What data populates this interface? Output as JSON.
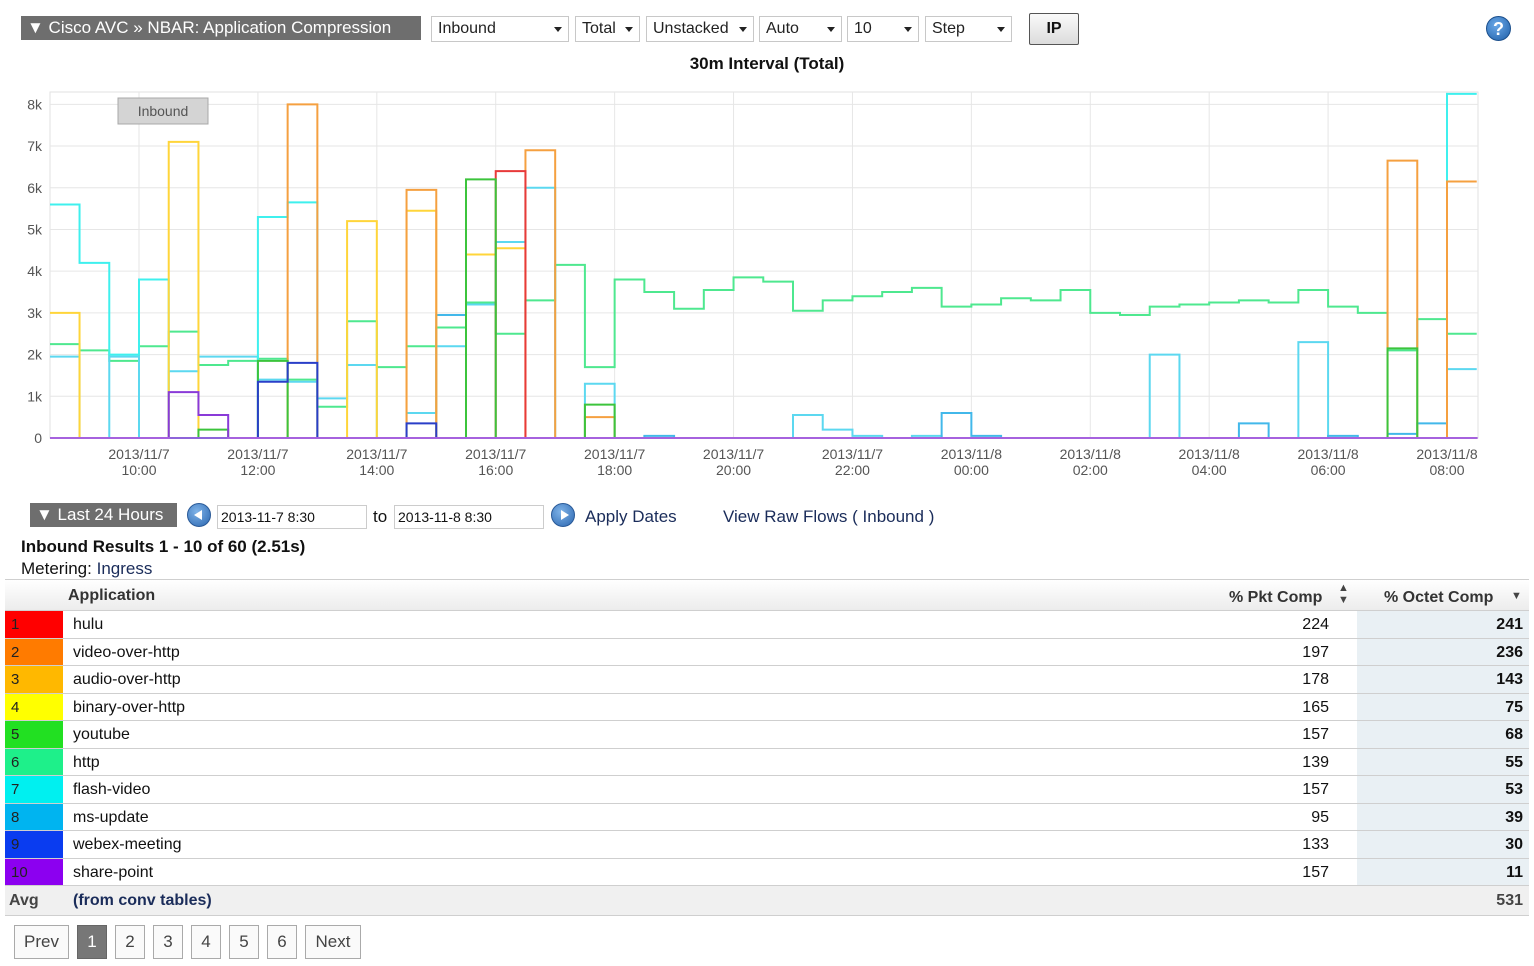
{
  "toolbar": {
    "title": "▼ Cisco AVC » NBAR: Application Compression",
    "direction": "Inbound",
    "total": "Total",
    "stack": "Unstacked",
    "scale": "Auto",
    "count": "10",
    "mode": "Step",
    "ip_label": "IP",
    "help": "?"
  },
  "chart_title": "30m Interval (Total)",
  "chart_data": {
    "type": "line",
    "title": "30m Interval (Total)",
    "legend": "Inbound",
    "y_ticks": [
      "0",
      "1k",
      "2k",
      "3k",
      "4k",
      "5k",
      "6k",
      "7k",
      "8k"
    ],
    "ylim": [
      0,
      8200
    ],
    "x_ticks": [
      {
        "date": "2013/11/7",
        "time": "10:00",
        "hour": 10
      },
      {
        "date": "2013/11/7",
        "time": "12:00",
        "hour": 12
      },
      {
        "date": "2013/11/7",
        "time": "14:00",
        "hour": 14
      },
      {
        "date": "2013/11/7",
        "time": "16:00",
        "hour": 16
      },
      {
        "date": "2013/11/7",
        "time": "18:00",
        "hour": 18
      },
      {
        "date": "2013/11/7",
        "time": "20:00",
        "hour": 20
      },
      {
        "date": "2013/11/7",
        "time": "22:00",
        "hour": 22
      },
      {
        "date": "2013/11/8",
        "time": "00:00",
        "hour": 24
      },
      {
        "date": "2013/11/8",
        "time": "02:00",
        "hour": 26
      },
      {
        "date": "2013/11/8",
        "time": "04:00",
        "hour": 28
      },
      {
        "date": "2013/11/8",
        "time": "06:00",
        "hour": 30
      },
      {
        "date": "2013/11/8",
        "time": "08:00",
        "hour": 32
      }
    ],
    "x_start_hour": 8.5,
    "interval_hours": 0.5,
    "series": [
      {
        "color": "#4ee88f",
        "values": [
          2250,
          2100,
          1850,
          2200,
          2550,
          1750,
          1850,
          1900,
          1400,
          750,
          2800,
          1700,
          2200,
          2650,
          3250,
          2500,
          3300,
          4150,
          1700,
          3800,
          3500,
          3100,
          3550,
          3850,
          3750,
          3050,
          3300,
          3400,
          3500,
          3600,
          3150,
          3200,
          3350,
          3300,
          3550,
          3000,
          2950,
          3150,
          3200,
          3250,
          3300,
          3250,
          3550,
          3150,
          3000,
          2100,
          2850,
          2500
        ]
      },
      {
        "color": "#5cd8f0",
        "values": [
          1950,
          0,
          1950,
          0,
          1600,
          1950,
          1950,
          1400,
          1350,
          950,
          1750,
          0,
          600,
          2200,
          3200,
          4700,
          6000,
          0,
          1300,
          0,
          0,
          0,
          0,
          0,
          0,
          550,
          200,
          50,
          0,
          50,
          0,
          0,
          0,
          0,
          0,
          0,
          0,
          2000,
          0,
          0,
          0,
          0,
          2300,
          0,
          0,
          0,
          0,
          1650
        ]
      },
      {
        "color": "#3ff0ee",
        "values": [
          5600,
          4200,
          2000,
          3800,
          0,
          0,
          0,
          5300,
          5650,
          0,
          0,
          0,
          0,
          0,
          0,
          0,
          0,
          0,
          0,
          0,
          0,
          0,
          0,
          0,
          0,
          0,
          0,
          0,
          0,
          0,
          0,
          0,
          0,
          0,
          0,
          0,
          0,
          0,
          0,
          0,
          0,
          0,
          0,
          0,
          0,
          0,
          0,
          8250
        ]
      },
      {
        "color": "#42b8ea",
        "values": [
          0,
          0,
          0,
          0,
          0,
          0,
          0,
          0,
          0,
          0,
          0,
          0,
          0,
          2950,
          0,
          0,
          0,
          0,
          0,
          0,
          50,
          0,
          0,
          0,
          0,
          0,
          0,
          0,
          0,
          0,
          600,
          50,
          0,
          0,
          0,
          0,
          0,
          0,
          0,
          0,
          350,
          0,
          0,
          50,
          0,
          100,
          350,
          0
        ]
      },
      {
        "color": "#ffd53a",
        "values": [
          3000,
          0,
          0,
          0,
          7100,
          0,
          0,
          0,
          0,
          0,
          5200,
          0,
          5450,
          0,
          4400,
          4550,
          0,
          0,
          0,
          0,
          0,
          0,
          0,
          0,
          0,
          0,
          0,
          0,
          0,
          0,
          0,
          0,
          0,
          0,
          0,
          0,
          0,
          0,
          0,
          0,
          0,
          0,
          0,
          0,
          0,
          0,
          0,
          0
        ]
      },
      {
        "color": "#f5a040",
        "values": [
          0,
          0,
          0,
          0,
          0,
          0,
          0,
          0,
          8000,
          0,
          0,
          0,
          5950,
          0,
          0,
          0,
          6900,
          0,
          500,
          0,
          0,
          0,
          0,
          0,
          0,
          0,
          0,
          0,
          0,
          0,
          0,
          0,
          0,
          0,
          0,
          0,
          0,
          0,
          0,
          0,
          0,
          0,
          0,
          0,
          0,
          6650,
          0,
          6150
        ]
      },
      {
        "color": "#e83a3a",
        "values": [
          0,
          0,
          0,
          0,
          0,
          0,
          0,
          0,
          0,
          0,
          0,
          0,
          0,
          0,
          0,
          6400,
          0,
          0,
          0,
          0,
          0,
          0,
          0,
          0,
          0,
          0,
          0,
          0,
          0,
          0,
          0,
          0,
          0,
          0,
          0,
          0,
          0,
          0,
          0,
          0,
          0,
          0,
          0,
          0,
          0,
          0,
          0,
          0
        ]
      },
      {
        "color": "#3cc43c",
        "values": [
          0,
          0,
          0,
          0,
          0,
          200,
          0,
          1850,
          0,
          0,
          0,
          0,
          0,
          0,
          6200,
          0,
          0,
          0,
          800,
          0,
          0,
          0,
          0,
          0,
          0,
          0,
          0,
          0,
          0,
          0,
          0,
          0,
          0,
          0,
          0,
          0,
          0,
          0,
          0,
          0,
          0,
          0,
          0,
          0,
          0,
          2150,
          0,
          0
        ]
      },
      {
        "color": "#2a3fc8",
        "values": [
          0,
          0,
          0,
          0,
          0,
          0,
          0,
          1350,
          1800,
          0,
          0,
          0,
          350,
          0,
          0,
          0,
          0,
          0,
          0,
          0,
          0,
          0,
          0,
          0,
          0,
          0,
          0,
          0,
          0,
          0,
          0,
          0,
          0,
          0,
          0,
          0,
          0,
          0,
          0,
          0,
          0,
          0,
          0,
          0,
          0,
          0,
          0,
          0
        ]
      },
      {
        "color": "#8a3ad8",
        "values": [
          0,
          0,
          0,
          0,
          1100,
          550,
          0,
          0,
          0,
          0,
          0,
          0,
          0,
          0,
          0,
          0,
          0,
          0,
          0,
          0,
          0,
          0,
          0,
          0,
          0,
          0,
          0,
          0,
          0,
          0,
          0,
          0,
          0,
          0,
          0,
          0,
          0,
          0,
          0,
          0,
          0,
          0,
          0,
          0,
          0,
          0,
          0,
          0
        ]
      }
    ]
  },
  "date_range": {
    "preset": "▼ Last 24 Hours",
    "from": "2013-11-7 8:30",
    "to_label": "to",
    "to": "2013-11-8 8:30",
    "apply": "Apply Dates",
    "view_raw": "View Raw Flows (",
    "view_raw_link": "Inbound",
    "view_raw_end": ")"
  },
  "results": {
    "title": "Inbound Results 1 - 10 of 60 (2.51s)",
    "metering_label": "Metering:",
    "metering_value": "Ingress"
  },
  "table": {
    "headers": {
      "application": "Application",
      "pkt": "% Pkt Comp",
      "octet": "% Octet Comp"
    },
    "rows": [
      {
        "rank": "1",
        "color": "#ff0000",
        "app": "hulu",
        "pkt": "224",
        "octet": "241"
      },
      {
        "rank": "2",
        "color": "#ff7b00",
        "app": "video-over-http",
        "pkt": "197",
        "octet": "236"
      },
      {
        "rank": "3",
        "color": "#ffb800",
        "app": "audio-over-http",
        "pkt": "178",
        "octet": "143"
      },
      {
        "rank": "4",
        "color": "#ffff00",
        "app": "binary-over-http",
        "pkt": "165",
        "octet": "75"
      },
      {
        "rank": "5",
        "color": "#22e022",
        "app": "youtube",
        "pkt": "157",
        "octet": "68"
      },
      {
        "rank": "6",
        "color": "#1ef08a",
        "app": "http",
        "pkt": "139",
        "octet": "55"
      },
      {
        "rank": "7",
        "color": "#00f0f0",
        "app": "flash-video",
        "pkt": "157",
        "octet": "53"
      },
      {
        "rank": "8",
        "color": "#00b4f0",
        "app": "ms-update",
        "pkt": "95",
        "octet": "39"
      },
      {
        "rank": "9",
        "color": "#0a3cf0",
        "app": "webex-meeting",
        "pkt": "133",
        "octet": "30"
      },
      {
        "rank": "10",
        "color": "#8c00f0",
        "app": "share-point",
        "pkt": "157",
        "octet": "11"
      }
    ],
    "avg": {
      "label": "Avg",
      "note": "(from conv tables)",
      "value": "531"
    }
  },
  "pagination": {
    "prev": "Prev",
    "pages": [
      "1",
      "2",
      "3",
      "4",
      "5",
      "6"
    ],
    "next": "Next",
    "current": "1"
  }
}
